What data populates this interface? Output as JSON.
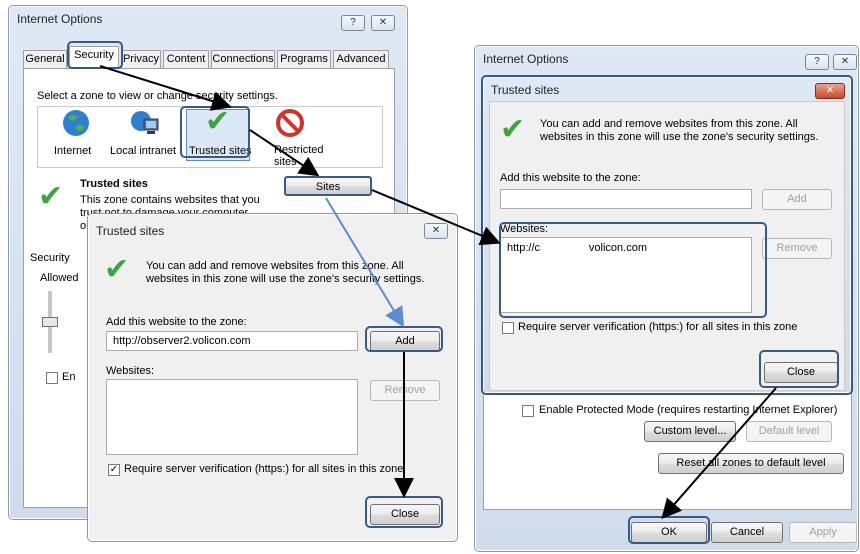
{
  "main_dialog": {
    "title": "Internet Options",
    "help_button": "?",
    "close_button": "✕",
    "tabs": [
      {
        "label": "General"
      },
      {
        "label": "Security"
      },
      {
        "label": "Privacy"
      },
      {
        "label": "Content"
      },
      {
        "label": "Connections"
      },
      {
        "label": "Programs"
      },
      {
        "label": "Advanced"
      }
    ],
    "zone_prompt": "Select a zone to view or change security settings.",
    "zones": [
      {
        "label": "Internet",
        "icon": "globe-icon"
      },
      {
        "label": "Local intranet",
        "icon": "intranet-icon"
      },
      {
        "label": "Trusted sites",
        "icon": "check-icon"
      },
      {
        "label": "Restricted sites",
        "icon": "no-entry-icon"
      }
    ],
    "zone_heading": "Trusted sites",
    "zone_desc": "This zone contains websites that you trust not to damage your computer or y",
    "sites_button": "Sites",
    "security_group": "Security",
    "allowed_label": "Allowed",
    "enable_partial": "En"
  },
  "trusted_left": {
    "title": "Trusted sites",
    "close_button": "✕",
    "intro": "You can add and remove websites from this zone. All websites in this zone will use the zone's security settings.",
    "add_label": "Add this website to the zone:",
    "add_value": "http://observer2.volicon.com",
    "add_button": "Add",
    "websites_label": "Websites:",
    "remove_button": "Remove",
    "require_https": "Require server verification (https:) for all sites in this zone",
    "require_checked": "✓",
    "close_label": "Close"
  },
  "right_dialog": {
    "title": "Internet Options",
    "help_button": "?",
    "close_button": "✕",
    "protected_mode": "Enable Protected Mode (requires restarting Internet Explorer)",
    "custom_level": "Custom level...",
    "default_level": "Default level",
    "reset_all": "Reset all zones to default level",
    "ok": "OK",
    "cancel": "Cancel",
    "apply": "Apply"
  },
  "trusted_right": {
    "title": "Trusted sites",
    "close_button": "✕",
    "intro": "You can add and remove websites from this zone. All websites in this zone will use the zone's security settings.",
    "add_label": "Add this website to the zone:",
    "add_value": "",
    "add_button": "Add",
    "websites_label": "Websites:",
    "website_entries": [
      "http://c                volicon.com"
    ],
    "remove_button": "Remove",
    "require_https": "Require server verification (https:) for all sites in this zone",
    "close_label": "Close"
  }
}
